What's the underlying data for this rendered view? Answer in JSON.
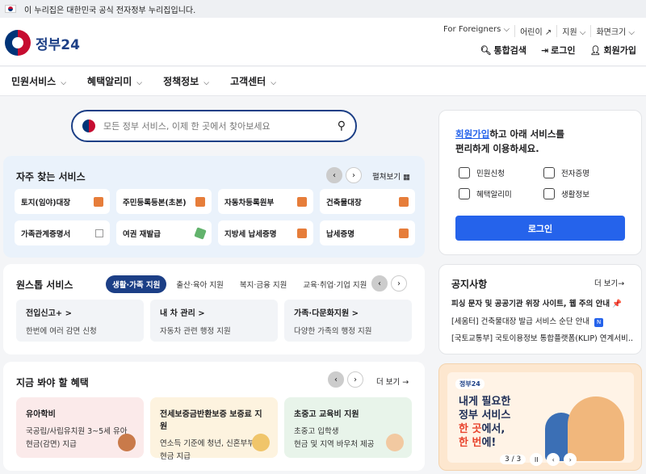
{
  "gov_banner": "이 누리집은 대한민국 공식 전자정부 누리집입니다.",
  "logo": "정부24",
  "util": [
    "For Foreigners ⌵",
    "어린이 ↗",
    "지원 ⌵",
    "화면크기 ⌵"
  ],
  "actions": {
    "search": "통합검색",
    "login": "로그인",
    "join": "회원가입"
  },
  "gnb": [
    "민원서비스",
    "혜택알리미",
    "정책정보",
    "고객센터"
  ],
  "search": {
    "placeholder": "모든 정부 서비스, 이제 한 곳에서 찾아보세요"
  },
  "freq": {
    "title": "자주 찾는 서비스",
    "expand": "펼쳐보기 ▦",
    "items": [
      "토지(임야)대장",
      "주민등록등본(초본)",
      "자동차등록원부",
      "건축물대장",
      "가족관계증명서",
      "여권 재발급",
      "지방세 납세증명",
      "납세증명"
    ]
  },
  "onestop": {
    "title": "원스톱 서비스",
    "chips": [
      "생활·가족 지원",
      "출산·육아 지원",
      "복지·금융 지원",
      "교육·취업·기업 지원"
    ],
    "tiles": [
      {
        "title": "전입신고+ >",
        "desc": "한번에 여러 감면 신청"
      },
      {
        "title": "내 차 관리 >",
        "desc": "자동차 관련 행정 지원"
      },
      {
        "title": "가족·다문화지원 >",
        "desc": "다양한 가족의 행정 지원"
      }
    ]
  },
  "benefit": {
    "title": "지금 봐야 할 혜택",
    "more": "더 보기 →",
    "tiles": [
      {
        "title": "유아학비",
        "l1": "국공립/사립유치원 3~5세 유아",
        "l2": "현금(감면) 지급",
        "color": "#fbeaea"
      },
      {
        "title": "전세보증금반환보증 보증료 지원",
        "l1": "연소득 기준에 청년, 신혼부부 등",
        "l2": "현금 지급",
        "color": "#fdf3df"
      },
      {
        "title": "초중고 교육비 지원",
        "l1": "초중고 입학생",
        "l2": "현금 및 지역 바우처 제공",
        "color": "#e8f4ea"
      }
    ]
  },
  "login_box": {
    "join_link": "회원가입",
    "line1": "하고 아래 서비스를",
    "line2": "편리하게 이용하세요.",
    "services": [
      "민원신청",
      "전자증명",
      "혜택알리미",
      "생활정보"
    ],
    "button": "로그인"
  },
  "notice": {
    "title": "공지사항",
    "more": "더 보기→",
    "items": [
      "피싱 문자 및 공공기관 위장 사이트, 웹 주의 안내 📌",
      "[세움터] 건축물대장 발급 서비스 순단 안내",
      "[국토교통부] 국토이용정보 통합플랫폼(KLIP) 연계서비…"
    ],
    "badge": "N"
  },
  "promo": {
    "logo": "정부24",
    "l1": "내게 필요한",
    "l2": "정부 서비스",
    "l3a": "한 곳",
    "l3b": "에서,",
    "l4a": "한 번",
    "l4b": "에!",
    "page": "3 / 3",
    "pause": "II",
    "prev": "‹",
    "next": "›"
  }
}
